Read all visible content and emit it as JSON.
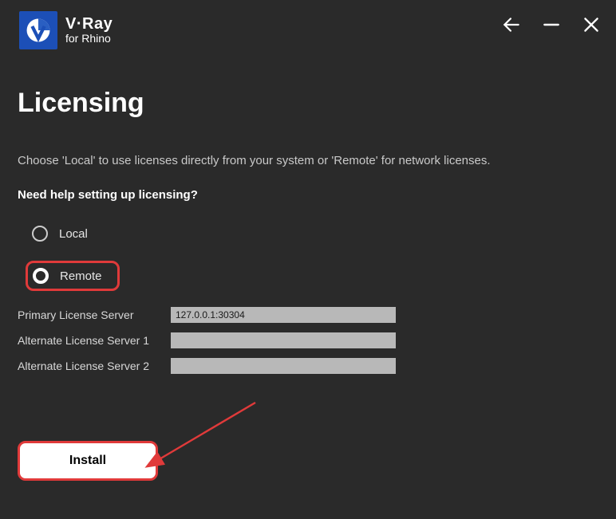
{
  "header": {
    "product": "V·Ray",
    "subproduct": "for Rhino"
  },
  "page": {
    "title": "Licensing",
    "description": "Choose 'Local' to use licenses directly from your system or 'Remote' for network licenses.",
    "help_link": "Need help setting up licensing?"
  },
  "options": {
    "local_label": "Local",
    "remote_label": "Remote",
    "selected": "remote"
  },
  "servers": {
    "primary": {
      "label": "Primary License Server",
      "value": "127.0.0.1:30304"
    },
    "alt1": {
      "label": "Alternate License Server 1",
      "value": ""
    },
    "alt2": {
      "label": "Alternate License Server 2",
      "value": ""
    }
  },
  "buttons": {
    "install": "Install"
  },
  "colors": {
    "highlight": "#e03a3a",
    "brand": "#1c4fb7"
  }
}
